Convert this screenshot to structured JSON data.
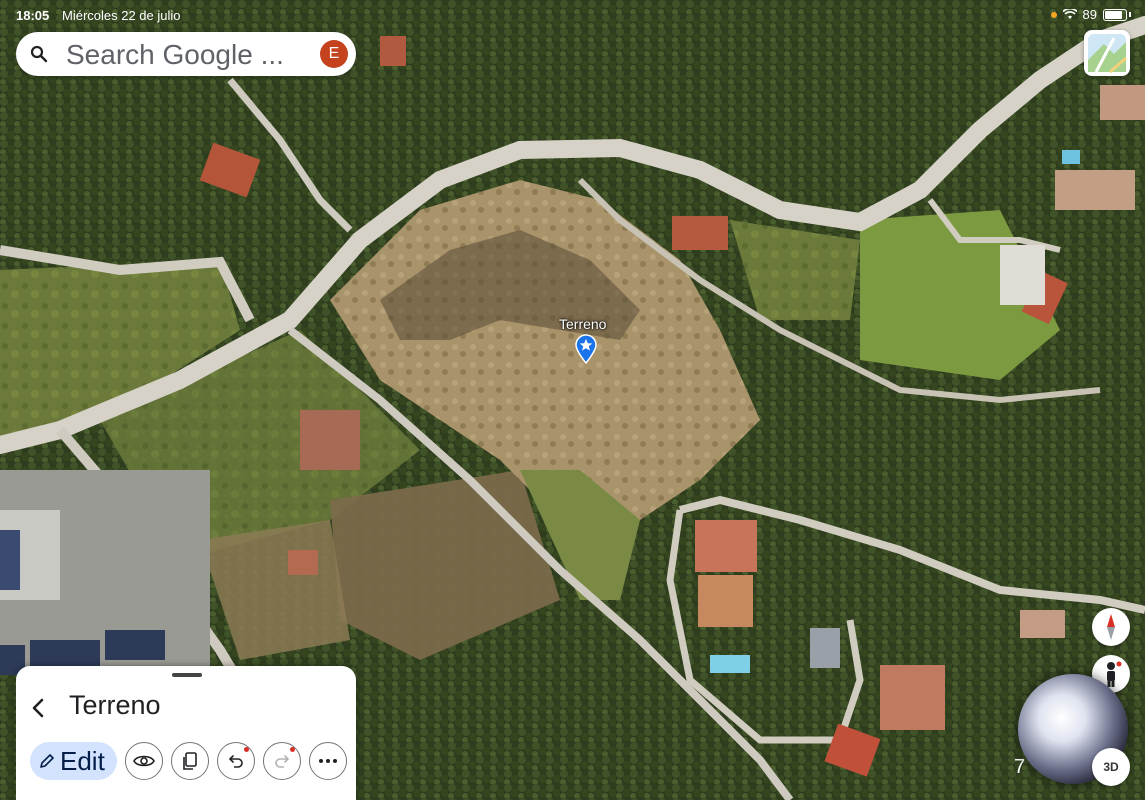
{
  "status_bar": {
    "time": "18:05",
    "date": "Miércoles 22 de julio",
    "battery": "89"
  },
  "search": {
    "placeholder": "Search Google ...",
    "avatar_letter": "E"
  },
  "place": {
    "label": "Terreno"
  },
  "sheet": {
    "title": "Terreno",
    "edit_label": "Edit"
  },
  "map_controls": {
    "scale_label": "7",
    "view_3d_label": "3D"
  },
  "colors": {
    "accent": "#d3e3fd",
    "avatar": "#c5421e",
    "pin": "#1a73e8"
  },
  "icons": [
    "search-icon",
    "layers-icon",
    "back-icon",
    "pencil-icon",
    "eye-icon",
    "copy-icon",
    "undo-icon",
    "redo-icon",
    "more-icon",
    "compass-icon",
    "pegman-icon",
    "star-pin-icon"
  ]
}
